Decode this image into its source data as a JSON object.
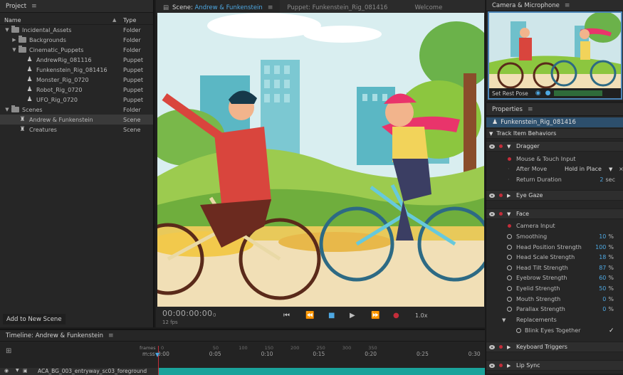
{
  "project": {
    "title": "Project",
    "col_name": "Name",
    "col_type": "Type",
    "items": [
      {
        "name": "Incidental_Assets",
        "type": "Folder",
        "kind": "folder",
        "depth": 0,
        "twirl": "▼"
      },
      {
        "name": "Backgrounds",
        "type": "Folder",
        "kind": "folder",
        "depth": 1,
        "twirl": "▶"
      },
      {
        "name": "Cinematic_Puppets",
        "type": "Folder",
        "kind": "folder",
        "depth": 1,
        "twirl": "▼"
      },
      {
        "name": "AndrewRig_081116",
        "type": "Puppet",
        "kind": "puppet",
        "depth": 2,
        "twirl": ""
      },
      {
        "name": "Funkenstein_Rig_081416",
        "type": "Puppet",
        "kind": "puppet",
        "depth": 2,
        "twirl": ""
      },
      {
        "name": "Monster_Rig_0720",
        "type": "Puppet",
        "kind": "puppet",
        "depth": 2,
        "twirl": ""
      },
      {
        "name": "Robot_Rig_0720",
        "type": "Puppet",
        "kind": "puppet",
        "depth": 2,
        "twirl": ""
      },
      {
        "name": "UFO_Rig_0720",
        "type": "Puppet",
        "kind": "puppet",
        "depth": 2,
        "twirl": ""
      },
      {
        "name": "Scenes",
        "type": "Folder",
        "kind": "folder",
        "depth": 0,
        "twirl": "▼"
      },
      {
        "name": "Andrew & Funkenstein",
        "type": "Scene",
        "kind": "scene",
        "depth": 1,
        "twirl": "",
        "selected": true
      },
      {
        "name": "Creatures",
        "type": "Scene",
        "kind": "scene",
        "depth": 1,
        "twirl": ""
      }
    ],
    "add_scene_label": "Add to New Scene"
  },
  "scene": {
    "tab_scene_prefix": "Scene:",
    "tab_scene_name": "Andrew & Funkenstein",
    "tab_puppet": "Puppet: Funkenstein_Rig_081416",
    "tab_welcome": "Welcome",
    "timecode": "00:00:00:00",
    "timecode_suffix": "0",
    "fps": "12 fps",
    "speed": "1.0x"
  },
  "camera": {
    "title": "Camera & Microphone",
    "set_rest_pose": "Set Rest Pose"
  },
  "properties": {
    "title": "Properties",
    "puppet_name": "Funkenstein_Rig_081416",
    "track_behaviors": "Track Item Behaviors",
    "dragger": "Dragger",
    "mouse_touch": "Mouse & Touch Input",
    "after_move": "After Move",
    "after_move_value": "Hold in Place",
    "return_duration": "Return Duration",
    "return_duration_value": "2",
    "return_duration_unit": "sec",
    "eye_gaze": "Eye Gaze",
    "face": "Face",
    "camera_input": "Camera Input",
    "params": [
      {
        "label": "Smoothing",
        "value": "10",
        "unit": "%"
      },
      {
        "label": "Head Position Strength",
        "value": "100",
        "unit": "%"
      },
      {
        "label": "Head Scale Strength",
        "value": "18",
        "unit": "%"
      },
      {
        "label": "Head Tilt Strength",
        "value": "87",
        "unit": "%"
      },
      {
        "label": "Eyebrow Strength",
        "value": "60",
        "unit": "%"
      },
      {
        "label": "Eyelid Strength",
        "value": "50",
        "unit": "%"
      },
      {
        "label": "Mouth Strength",
        "value": "0",
        "unit": "%"
      },
      {
        "label": "Parallax Strength",
        "value": "0",
        "unit": "%"
      }
    ],
    "replacements": "Replacements",
    "blink": "Blink Eyes Together",
    "keyboard_triggers": "Keyboard Triggers",
    "lip_sync": "Lip Sync"
  },
  "timeline": {
    "title": "Timeline: Andrew & Funkenstein",
    "frames_label": "frames",
    "mss_label": "m:ss",
    "ticks": [
      "0:00",
      "0:05",
      "0:10",
      "0:15",
      "0:20",
      "0:25",
      "0:30"
    ],
    "frame_ticks": [
      "0",
      "50",
      "100",
      "150",
      "200",
      "250",
      "300",
      "350"
    ],
    "track_name": "ACA_BG_003_entryway_sc03_foreground"
  },
  "colors": {
    "accent": "#4ea8e2",
    "selection": "#2d4f6c",
    "record": "#c42d3a",
    "track": "#1aa39b"
  }
}
